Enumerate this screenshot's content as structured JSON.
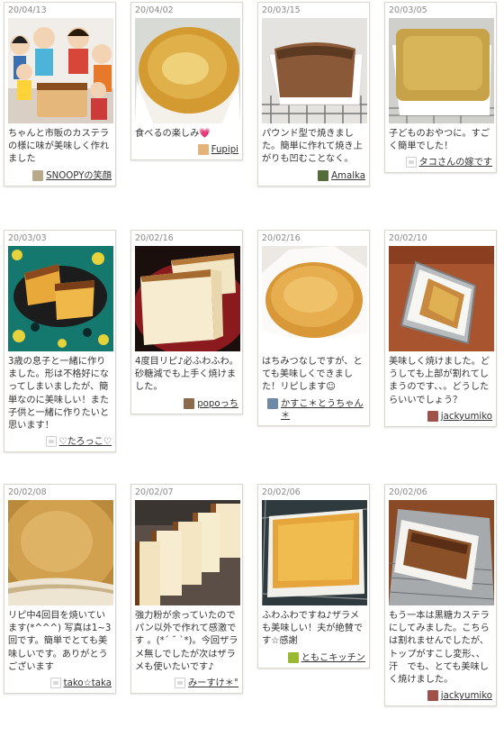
{
  "cards": [
    {
      "date": "20/04/13",
      "text": "ちゃんと市販のカステラの様に味が美味しく作れました",
      "user": "SNOOPYの笑顔",
      "image": "castella-with-toy-figures",
      "avatar": "photo-avatar",
      "avatar_color": "#b7a98a"
    },
    {
      "date": "20/04/02",
      "text": "食べるの楽しみ💗",
      "user": "Fupipi",
      "image": "round-cake-in-paper",
      "avatar": "photo-avatar",
      "avatar_color": "#e4b37a"
    },
    {
      "date": "20/03/15",
      "text": "パウンド型で焼きました。簡単に作れて焼き上がりも凹むことなく。",
      "user": "Amalka",
      "image": "pound-cake-on-rack",
      "avatar": "photo-avatar",
      "avatar_color": "#556b3a"
    },
    {
      "date": "20/03/05",
      "text": "子どものおやつに。すごく簡単でした！",
      "user": "タコさんの嫁です",
      "image": "square-cake-on-rack",
      "avatar": "default-avatar",
      "avatar_color": "#ffffff"
    },
    {
      "date": "20/03/03",
      "text": "3歳の息子と一緒に作りました。形は不格好になってしまいましたが、簡単なのに美味しい！また子供と一緒に作りたいと思います！",
      "user": "♡たろっこ♡",
      "image": "cake-slices-on-plate",
      "avatar": "default-avatar",
      "avatar_color": "#ffffff"
    },
    {
      "date": "20/02/16",
      "text": "4度目リピ♪必ふわふわ。砂糖減でも上手く焼けました。",
      "user": "popoっち",
      "image": "sliced-loaf-red-plate",
      "avatar": "photo-avatar",
      "avatar_color": "#8a6a4a"
    },
    {
      "date": "20/02/16",
      "text": "はちみつなしですが、とても美味しくできました！リピします☺",
      "user": "かすこ＊とうちゃん＊",
      "image": "round-cake-top-view",
      "avatar": "photo-avatar",
      "avatar_color": "#6f8aa8"
    },
    {
      "date": "20/02/10",
      "text": "美味しく焼けました。どうしても上部が割れてしまうのです、、。どうしたらいいでしょう？",
      "user": "jackyumiko",
      "image": "pound-cake-in-tray",
      "avatar": "photo-avatar",
      "avatar_color": "#a0524a"
    },
    {
      "date": "20/02/08",
      "text": "リピ中4回目を焼いています(*^^^) 写真は1~3回です。簡単でとても美味しいです。ありがとうございます",
      "user": "tako☆taka",
      "image": "cake-top-closeup",
      "avatar": "default-avatar",
      "avatar_color": "#ffffff"
    },
    {
      "date": "20/02/07",
      "text": "強力粉が余っていたのでパン以外で作れて感激です 。(*´ ˘ `*)。今回ザラメ無しでしたが次はザラメも使いたいです♪",
      "user": "みーすけ＊°",
      "image": "sliced-castella-row",
      "avatar": "default-avatar",
      "avatar_color": "#ffffff"
    },
    {
      "date": "20/02/06",
      "text": "ふわふわですね♪ザラメも美味しい！夫が絶賛です☆感謝",
      "user": "ともこキッチン",
      "image": "square-cake-golden",
      "avatar": "photo-avatar",
      "avatar_color": "#9ab832"
    },
    {
      "date": "20/02/06",
      "text": "もう一本は黒糖カステラにしてみました。こちらは割れませんでしたが、トップがすこし変形、、汗　でも、とても美味しく焼けました。",
      "user": "jackyumiko",
      "image": "dark-loaf-in-tray",
      "avatar": "photo-avatar",
      "avatar_color": "#a0524a"
    }
  ]
}
